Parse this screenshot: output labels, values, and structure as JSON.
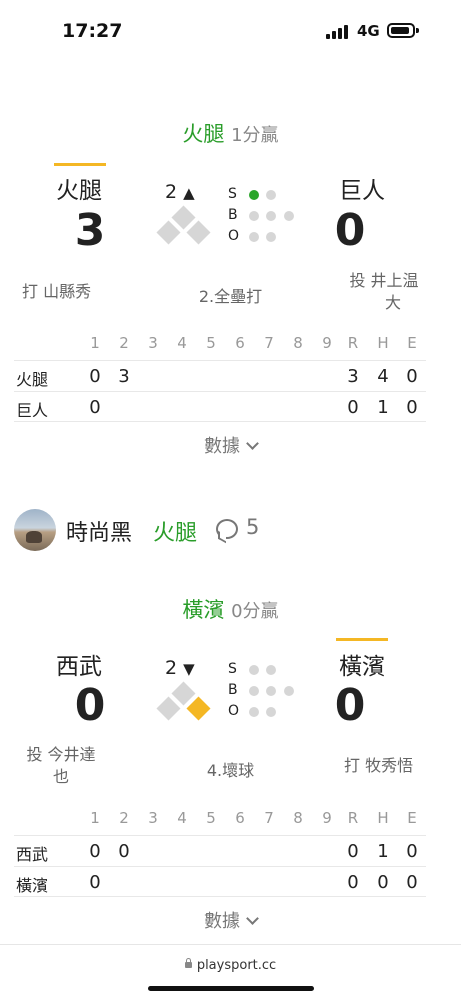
{
  "status": {
    "time": "17:27",
    "network": "4G"
  },
  "games": [
    {
      "result": {
        "winner": "火腿",
        "margin": "1分贏"
      },
      "away": {
        "name": "火腿",
        "score": "3",
        "player_role": "打",
        "player_name": "山縣秀"
      },
      "home": {
        "name": "巨人",
        "score": "0",
        "player_role": "投",
        "player_name_line1": "井上温",
        "player_name_line2": "大"
      },
      "batting_side": "away",
      "inning": {
        "number": "2",
        "half_symbol": "▲"
      },
      "count": {
        "strikes": 1,
        "balls": 0,
        "outs": 0,
        "labels": [
          "S",
          "B",
          "O"
        ]
      },
      "bases": {
        "first": false,
        "second": false,
        "third": false
      },
      "last_play": "2.全壘打",
      "linescore": {
        "headers": [
          "1",
          "2",
          "3",
          "4",
          "5",
          "6",
          "7",
          "8",
          "9",
          "R",
          "H",
          "E"
        ],
        "rows": [
          {
            "team": "火腿",
            "cells": [
              "0",
              "3",
              "",
              "",
              "",
              "",
              "",
              "",
              "",
              "3",
              "4",
              "0"
            ]
          },
          {
            "team": "巨人",
            "cells": [
              "0",
              "",
              "",
              "",
              "",
              "",
              "",
              "",
              "",
              "0",
              "1",
              "0"
            ]
          }
        ]
      },
      "more_label": "數據"
    },
    {
      "result": {
        "winner": "橫濱",
        "margin": "0分贏"
      },
      "away": {
        "name": "西武",
        "score": "0",
        "player_role": "投",
        "player_name_line1": "今井達",
        "player_name_line2": "也"
      },
      "home": {
        "name": "橫濱",
        "score": "0",
        "player_role": "打",
        "player_name": "牧秀悟"
      },
      "batting_side": "home",
      "inning": {
        "number": "2",
        "half_symbol": "▼"
      },
      "count": {
        "strikes": 0,
        "balls": 0,
        "outs": 0,
        "labels": [
          "S",
          "B",
          "O"
        ]
      },
      "bases": {
        "first": true,
        "second": false,
        "third": false
      },
      "last_play": "4.壞球",
      "linescore": {
        "headers": [
          "1",
          "2",
          "3",
          "4",
          "5",
          "6",
          "7",
          "8",
          "9",
          "R",
          "H",
          "E"
        ],
        "rows": [
          {
            "team": "西武",
            "cells": [
              "0",
              "0",
              "",
              "",
              "",
              "",
              "",
              "",
              "",
              "0",
              "1",
              "0"
            ]
          },
          {
            "team": "橫濱",
            "cells": [
              "0",
              "",
              "",
              "",
              "",
              "",
              "",
              "",
              "",
              "0",
              "0",
              "0"
            ]
          }
        ]
      },
      "more_label": "數據"
    }
  ],
  "comment": {
    "username": "時尚黑",
    "pick": "火腿",
    "count": "5",
    "icon": "speech-bubble-icon"
  },
  "footer": {
    "url": "playsport.cc"
  },
  "colors": {
    "win_green": "#2a9d2a",
    "batting_yellow": "#f4b724",
    "strike_dot": "#2aa52a",
    "inactive": "#d6d6d6"
  }
}
